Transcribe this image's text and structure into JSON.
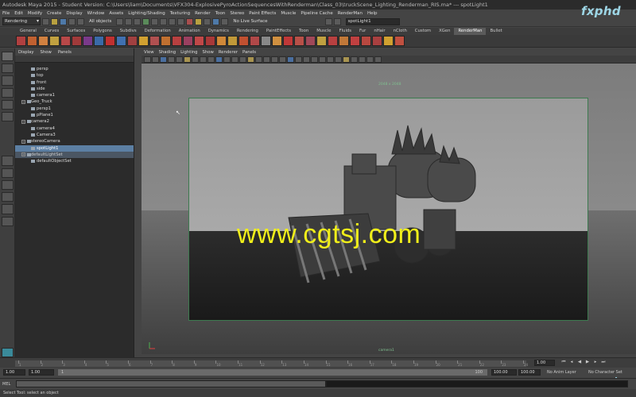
{
  "window": {
    "title": "Autodesk Maya 2015 - Student Version: C:\\Users\\liam\\Documents\\VFX304-ExplosivePyroActionSequencesWithRenderman\\Class_03\\truckScene_Lighting_Renderman_RIS.ma* --- spotLight1"
  },
  "menubar": [
    "File",
    "Edit",
    "Modify",
    "Create",
    "Display",
    "Window",
    "Assets",
    "Lighting/Shading",
    "Texturing",
    "Render",
    "Toon",
    "Stereo",
    "Paint Effects",
    "Muscle",
    "Pipeline Cache",
    "RenderMan",
    "Help"
  ],
  "statusline": {
    "mode": "Rendering",
    "object_mode": "All objects",
    "live_surface": "No Live Surface",
    "name_field": "spotLight1"
  },
  "shelf_tabs": [
    {
      "label": "General",
      "active": false
    },
    {
      "label": "Curves",
      "active": false
    },
    {
      "label": "Surfaces",
      "active": false
    },
    {
      "label": "Polygons",
      "active": false
    },
    {
      "label": "Subdivs",
      "active": false
    },
    {
      "label": "Deformation",
      "active": false
    },
    {
      "label": "Animation",
      "active": false
    },
    {
      "label": "Dynamics",
      "active": false
    },
    {
      "label": "Rendering",
      "active": false
    },
    {
      "label": "PaintEffects",
      "active": false
    },
    {
      "label": "Toon",
      "active": false
    },
    {
      "label": "Muscle",
      "active": false
    },
    {
      "label": "Fluids",
      "active": false
    },
    {
      "label": "Fur",
      "active": false
    },
    {
      "label": "nHair",
      "active": false
    },
    {
      "label": "nCloth",
      "active": false
    },
    {
      "label": "Custom",
      "active": false
    },
    {
      "label": "XGen",
      "active": false
    },
    {
      "label": "RenderMan",
      "active": true
    },
    {
      "label": "Bullet",
      "active": false
    }
  ],
  "shelf_icon_colors": [
    "#b04040",
    "#c06030",
    "#d08040",
    "#c0a040",
    "#b84848",
    "#a03a3a",
    "#7a3a8a",
    "#3a6aa8",
    "#c03030",
    "#4070b0",
    "#a04040",
    "#d0a030",
    "#b05050",
    "#c07030",
    "#b84040",
    "#9a4060",
    "#c04848",
    "#a83838",
    "#d08838",
    "#c09838",
    "#c05030",
    "#b04848",
    "#888888",
    "#d09040",
    "#c03838",
    "#b85048",
    "#a04858",
    "#c0a040",
    "#b84040",
    "#c07838",
    "#c04040",
    "#b84840",
    "#a84040",
    "#d0a030",
    "#c05040"
  ],
  "outliner": {
    "menu": [
      "Display",
      "Show",
      "Panels"
    ],
    "items": [
      {
        "label": "persp",
        "level": "child",
        "state": ""
      },
      {
        "label": "top",
        "level": "child",
        "state": ""
      },
      {
        "label": "front",
        "level": "child",
        "state": ""
      },
      {
        "label": "side",
        "level": "child",
        "state": ""
      },
      {
        "label": "camera1",
        "level": "child",
        "state": ""
      },
      {
        "label": "Geo_Truck",
        "level": "top",
        "state": ""
      },
      {
        "label": "persp1",
        "level": "child",
        "state": ""
      },
      {
        "label": "pPlane1",
        "level": "child",
        "state": ""
      },
      {
        "label": "camera2",
        "level": "top",
        "state": ""
      },
      {
        "label": "camera4",
        "level": "child",
        "state": ""
      },
      {
        "label": "Camera3",
        "level": "child",
        "state": ""
      },
      {
        "label": "stereoCamera",
        "level": "top",
        "state": ""
      },
      {
        "label": "spotLight1",
        "level": "child",
        "state": "selected"
      },
      {
        "label": "defaultLightSet",
        "level": "top",
        "state": "hl"
      },
      {
        "label": "defaultObjectSet",
        "level": "child",
        "state": ""
      }
    ]
  },
  "viewport": {
    "menu": [
      "View",
      "Shading",
      "Lighting",
      "Show",
      "Renderer",
      "Panels"
    ],
    "resolution_label": "2048 x 2048",
    "camera_label": "camera1",
    "watermark": "www.cgtsj.com"
  },
  "branding": {
    "logo": "fxphd",
    "corner_logo": "fxp"
  },
  "timeslider": {
    "current_frame": "1.00",
    "tick_labels": [
      "1",
      "2",
      "3",
      "4",
      "5",
      "6",
      "7",
      "8",
      "9",
      "10",
      "11",
      "12",
      "13",
      "14",
      "15",
      "16",
      "17",
      "18",
      "19",
      "20",
      "21",
      "22",
      "23",
      "24"
    ]
  },
  "rangeslider": {
    "start_field": "1.00",
    "start_range": "1.00",
    "range_start_label": "1",
    "range_end_label": "100",
    "end_range": "100.00",
    "end_field": "100.00",
    "anim_layer": "No Anim Layer",
    "character_set": "No Character Set"
  },
  "cmdline": {
    "label": "MEL"
  },
  "helpline": {
    "text": "Select Tool: select an object"
  }
}
